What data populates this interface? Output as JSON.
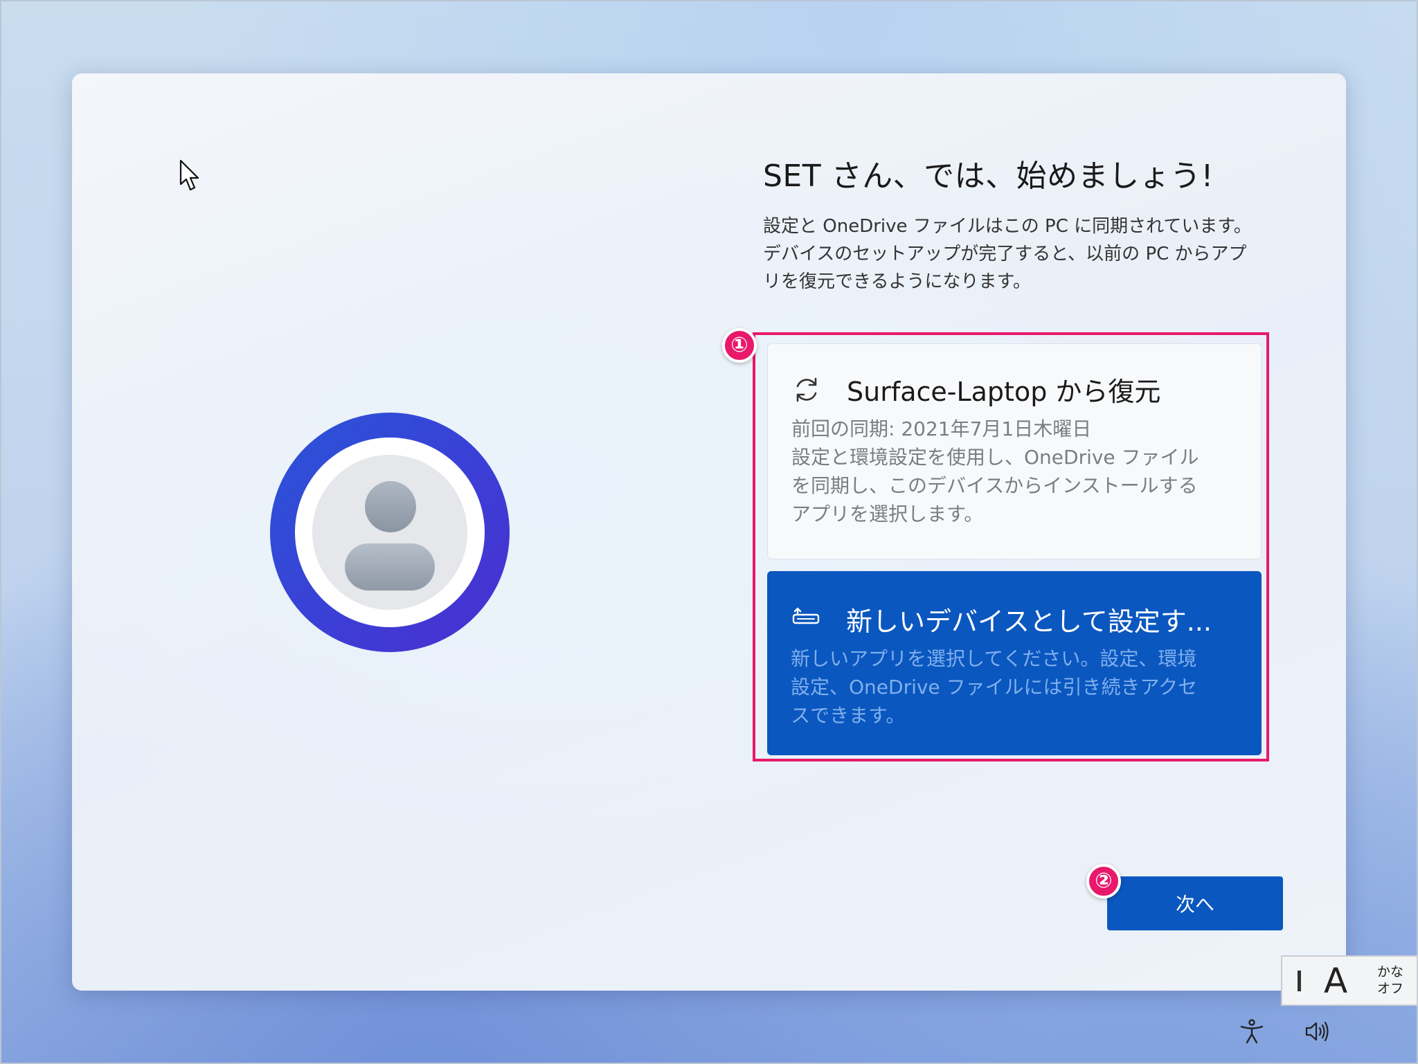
{
  "header": {
    "title": "SET さん、では、始めましょう!",
    "description_lines": [
      "設定と OneDrive ファイルはこの PC に同期されています。",
      "デバイスのセットアップが完了すると、以前の PC からアプ",
      "リを復元できるようになります。"
    ]
  },
  "annotations": {
    "badge_1": "①",
    "badge_2": "②"
  },
  "options": {
    "restore": {
      "icon": "sync-icon",
      "title": "Surface-Laptop から復元",
      "lines": [
        "前回の同期: 2021年7月1日木曜日",
        "設定と環境設定を使用し、OneDrive ファイル",
        "を同期し、このデバイスからインストールする",
        "アプリを選択します。"
      ]
    },
    "new_device": {
      "icon": "laptop-setup-icon",
      "title": "新しいデバイスとして設定す...",
      "lines": [
        "新しいアプリを選択してください。設定、環境",
        "設定、OneDrive ファイルには引き続きアクセ",
        "スできます。"
      ]
    }
  },
  "buttons": {
    "next_label": "次へ"
  },
  "ime": {
    "mode_letter": "A",
    "kana_top": "かな",
    "kana_bottom": "オフ"
  },
  "colors": {
    "accent": "#0b57c0",
    "highlight": "#e8196a"
  }
}
